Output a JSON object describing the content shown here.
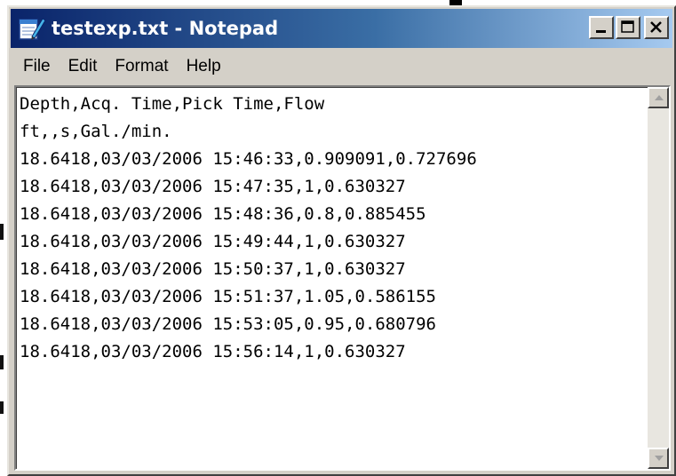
{
  "window": {
    "title": "testexp.txt - Notepad",
    "icon": "notepad-icon"
  },
  "title_buttons": {
    "minimize_icon": "minimize-icon",
    "maximize_icon": "maximize-icon",
    "close_icon": "close-icon"
  },
  "menu": {
    "items": [
      {
        "label": "File"
      },
      {
        "label": "Edit"
      },
      {
        "label": "Format"
      },
      {
        "label": "Help"
      }
    ]
  },
  "document": {
    "lines": [
      "Depth,Acq. Time,Pick Time,Flow",
      "ft,,s,Gal./min.",
      "18.6418,03/03/2006 15:46:33,0.909091,0.727696",
      "18.6418,03/03/2006 15:47:35,1,0.630327",
      "18.6418,03/03/2006 15:48:36,0.8,0.885455",
      "18.6418,03/03/2006 15:49:44,1,0.630327",
      "18.6418,03/03/2006 15:50:37,1,0.630327",
      "18.6418,03/03/2006 15:51:37,1.05,0.586155",
      "18.6418,03/03/2006 15:53:05,0.95,0.680796",
      "18.6418,03/03/2006 15:56:14,1,0.630327"
    ]
  },
  "scrollbar": {
    "up_icon": "scroll-up-arrow-icon",
    "down_icon": "scroll-down-arrow-icon"
  },
  "colors": {
    "titlebar_start": "#0a246a",
    "titlebar_end": "#a6caf0",
    "chrome": "#d4d0c8"
  }
}
